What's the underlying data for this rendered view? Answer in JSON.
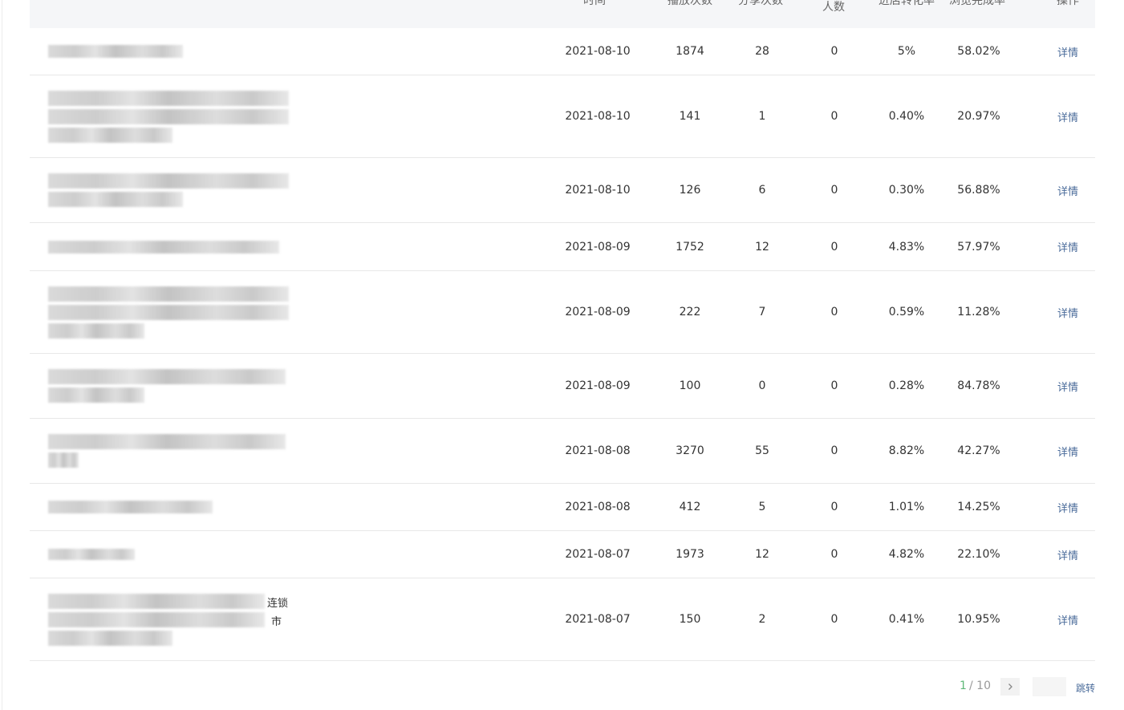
{
  "table": {
    "headers": {
      "time": "时间",
      "plays": "播放次数",
      "shares": "分享次数",
      "people": "人数",
      "rate1": "进店转化率",
      "rate2": "浏览完成率",
      "action": "操作"
    },
    "rows": [
      {
        "date": "2021-08-10",
        "plays": "1874",
        "shares": "28",
        "people": "0",
        "rate1": "5%",
        "rate2": "58.02%",
        "action": "详情"
      },
      {
        "date": "2021-08-10",
        "plays": "141",
        "shares": "1",
        "people": "0",
        "rate1": "0.40%",
        "rate2": "20.97%",
        "action": "详情"
      },
      {
        "date": "2021-08-10",
        "plays": "126",
        "shares": "6",
        "people": "0",
        "rate1": "0.30%",
        "rate2": "56.88%",
        "action": "详情"
      },
      {
        "date": "2021-08-09",
        "plays": "1752",
        "shares": "12",
        "people": "0",
        "rate1": "4.83%",
        "rate2": "57.97%",
        "action": "详情"
      },
      {
        "date": "2021-08-09",
        "plays": "222",
        "shares": "7",
        "people": "0",
        "rate1": "0.59%",
        "rate2": "11.28%",
        "action": "详情"
      },
      {
        "date": "2021-08-09",
        "plays": "100",
        "shares": "0",
        "people": "0",
        "rate1": "0.28%",
        "rate2": "84.78%",
        "action": "详情"
      },
      {
        "date": "2021-08-08",
        "plays": "3270",
        "shares": "55",
        "people": "0",
        "rate1": "8.82%",
        "rate2": "42.27%",
        "action": "详情"
      },
      {
        "date": "2021-08-08",
        "plays": "412",
        "shares": "5",
        "people": "0",
        "rate1": "1.01%",
        "rate2": "14.25%",
        "action": "详情"
      },
      {
        "date": "2021-08-07",
        "plays": "1973",
        "shares": "12",
        "people": "0",
        "rate1": "4.82%",
        "rate2": "22.10%",
        "action": "详情"
      },
      {
        "date": "2021-08-07",
        "plays": "150",
        "shares": "2",
        "people": "0",
        "rate1": "0.41%",
        "rate2": "10.95%",
        "action": "详情",
        "name_tail_1": "连锁",
        "name_tail_2": "市"
      }
    ]
  },
  "pagination": {
    "current": "1",
    "total": "/ 10",
    "jump_label": "跳转"
  },
  "colors": {
    "accent_green": "#5fb878",
    "link_blue": "#4a6b9a"
  },
  "icons": {
    "next_page": "chevron-right-icon"
  }
}
